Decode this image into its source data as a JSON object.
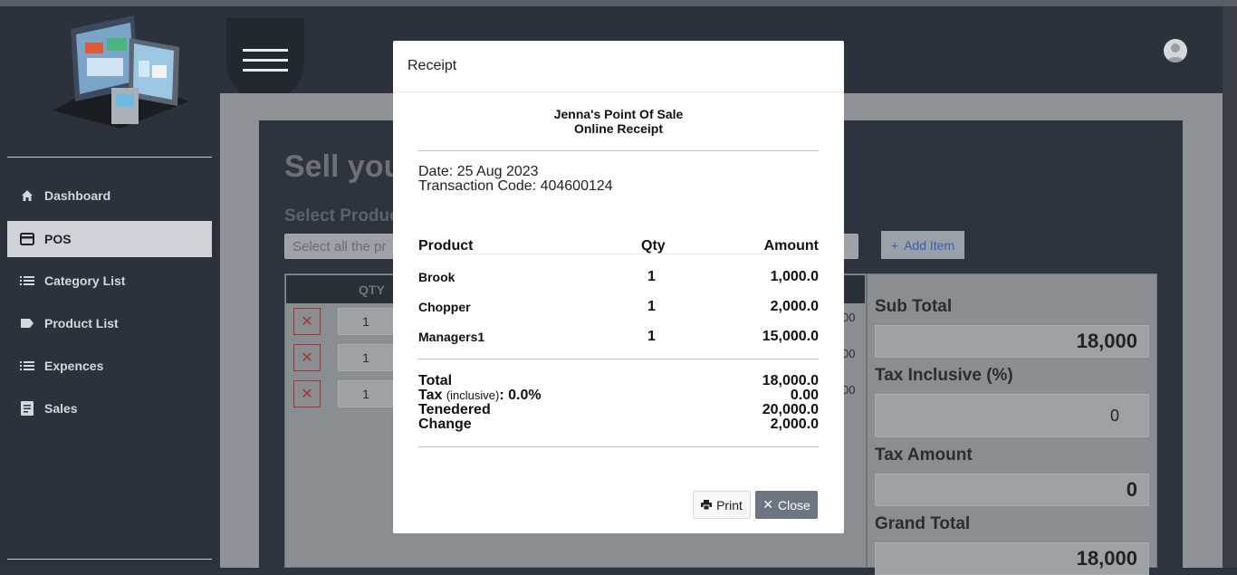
{
  "sidebar": {
    "items": [
      {
        "label": "Dashboard",
        "icon": "home-icon"
      },
      {
        "label": "POS",
        "icon": "card-icon",
        "active": true
      },
      {
        "label": "Category List",
        "icon": "list-icon"
      },
      {
        "label": "Product List",
        "icon": "label-icon"
      },
      {
        "label": "Expences",
        "icon": "list-icon"
      },
      {
        "label": "Sales",
        "icon": "document-icon"
      }
    ]
  },
  "main": {
    "title": "Sell you",
    "select_label": "Select Produc",
    "select_placeholder": "Select all the pr",
    "add_item_label": "Add Item",
    "table": {
      "qty_header": "QTY",
      "rows": [
        {
          "qty": "1",
          "amount": "00"
        },
        {
          "qty": "1",
          "amount": "00"
        },
        {
          "qty": "1",
          "amount": "00"
        }
      ]
    },
    "summary": {
      "sub_total_label": "Sub Total",
      "sub_total": "18,000",
      "tax_inclusive_label": "Tax Inclusive (%)",
      "tax_inclusive": "0",
      "tax_amount_label": "Tax Amount",
      "tax_amount": "0",
      "grand_total_label": "Grand Total",
      "grand_total": "18,000"
    }
  },
  "modal": {
    "title": "Receipt",
    "store_name": "Jenna's Point Of Sale",
    "store_subtitle": "Online Receipt",
    "date": "Date: 25 Aug 2023",
    "transaction": "Transaction Code: 404600124",
    "headers": {
      "product": "Product",
      "qty": "Qty",
      "amount": "Amount"
    },
    "items": [
      {
        "product": "Brook",
        "qty": "1",
        "amount": "1,000.0"
      },
      {
        "product": "Chopper",
        "qty": "1",
        "amount": "2,000.0"
      },
      {
        "product": "Managers1",
        "qty": "1",
        "amount": "15,000.0"
      }
    ],
    "totals": {
      "total_label": "Total",
      "total": "18,000.0",
      "tax_label": "Tax",
      "tax_note": "(inclusive)",
      "tax_rate": ": 0.0%",
      "tax": "0.00",
      "tendered_label": "Tenedered",
      "tendered": "20,000.0",
      "change_label": "Change",
      "change": "2,000.0"
    },
    "print_label": "Print",
    "close_label": "Close"
  },
  "colors": {
    "accent": "#3a5fb8",
    "danger": "#a5342d",
    "close_button": "#6b7682"
  }
}
